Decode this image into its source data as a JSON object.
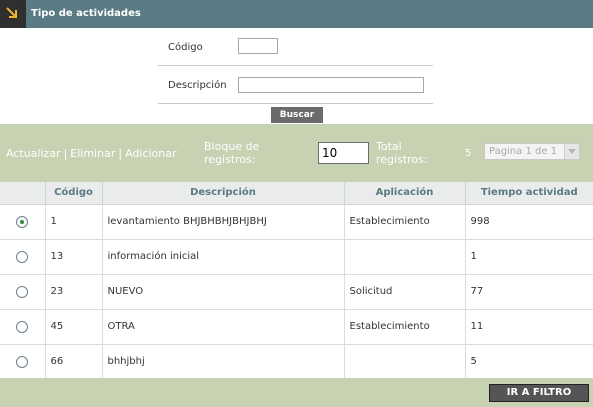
{
  "header": {
    "title": "Tipo de actividades",
    "icon": "arrow-down-right-icon"
  },
  "form": {
    "codigo_label": "Código",
    "codigo_value": "",
    "descripcion_label": "Descripción",
    "descripcion_value": "",
    "search_label": "Buscar"
  },
  "toolbar": {
    "actualizar": "Actualizar",
    "eliminar": "Eliminar",
    "adicionar": "Adicionar",
    "separator": "|",
    "bloque_label_1": "Bloque de",
    "bloque_label_2": "registros:",
    "bloque_value": "10",
    "total_label_1": "Total",
    "total_label_2": "registros:",
    "total_value": "5",
    "page_select": "Pagina 1 de 1"
  },
  "table": {
    "headers": [
      "",
      "Código",
      "Descripción",
      "Aplicación",
      "Tiempo actividad"
    ],
    "rows": [
      {
        "selected": true,
        "codigo": "1",
        "descripcion": "levantamiento BHJBHBHJBHJBHJ",
        "aplicacion": "Establecimiento",
        "tiempo": "998"
      },
      {
        "selected": false,
        "codigo": "13",
        "descripcion": "información inicial",
        "aplicacion": "",
        "tiempo": "1"
      },
      {
        "selected": false,
        "codigo": "23",
        "descripcion": "NUEVO",
        "aplicacion": "Solicitud",
        "tiempo": "77"
      },
      {
        "selected": false,
        "codigo": "45",
        "descripcion": "OTRA",
        "aplicacion": "Establecimiento",
        "tiempo": "11"
      },
      {
        "selected": false,
        "codigo": "66",
        "descripcion": "bhhjbhj",
        "aplicacion": "",
        "tiempo": "5"
      }
    ]
  },
  "footer": {
    "filter_button": "IR A FILTRO"
  },
  "colors": {
    "header_bg": "#5a7b83",
    "toolbar_bg": "#c7d2b3",
    "button_bg": "#6b6b6b"
  }
}
